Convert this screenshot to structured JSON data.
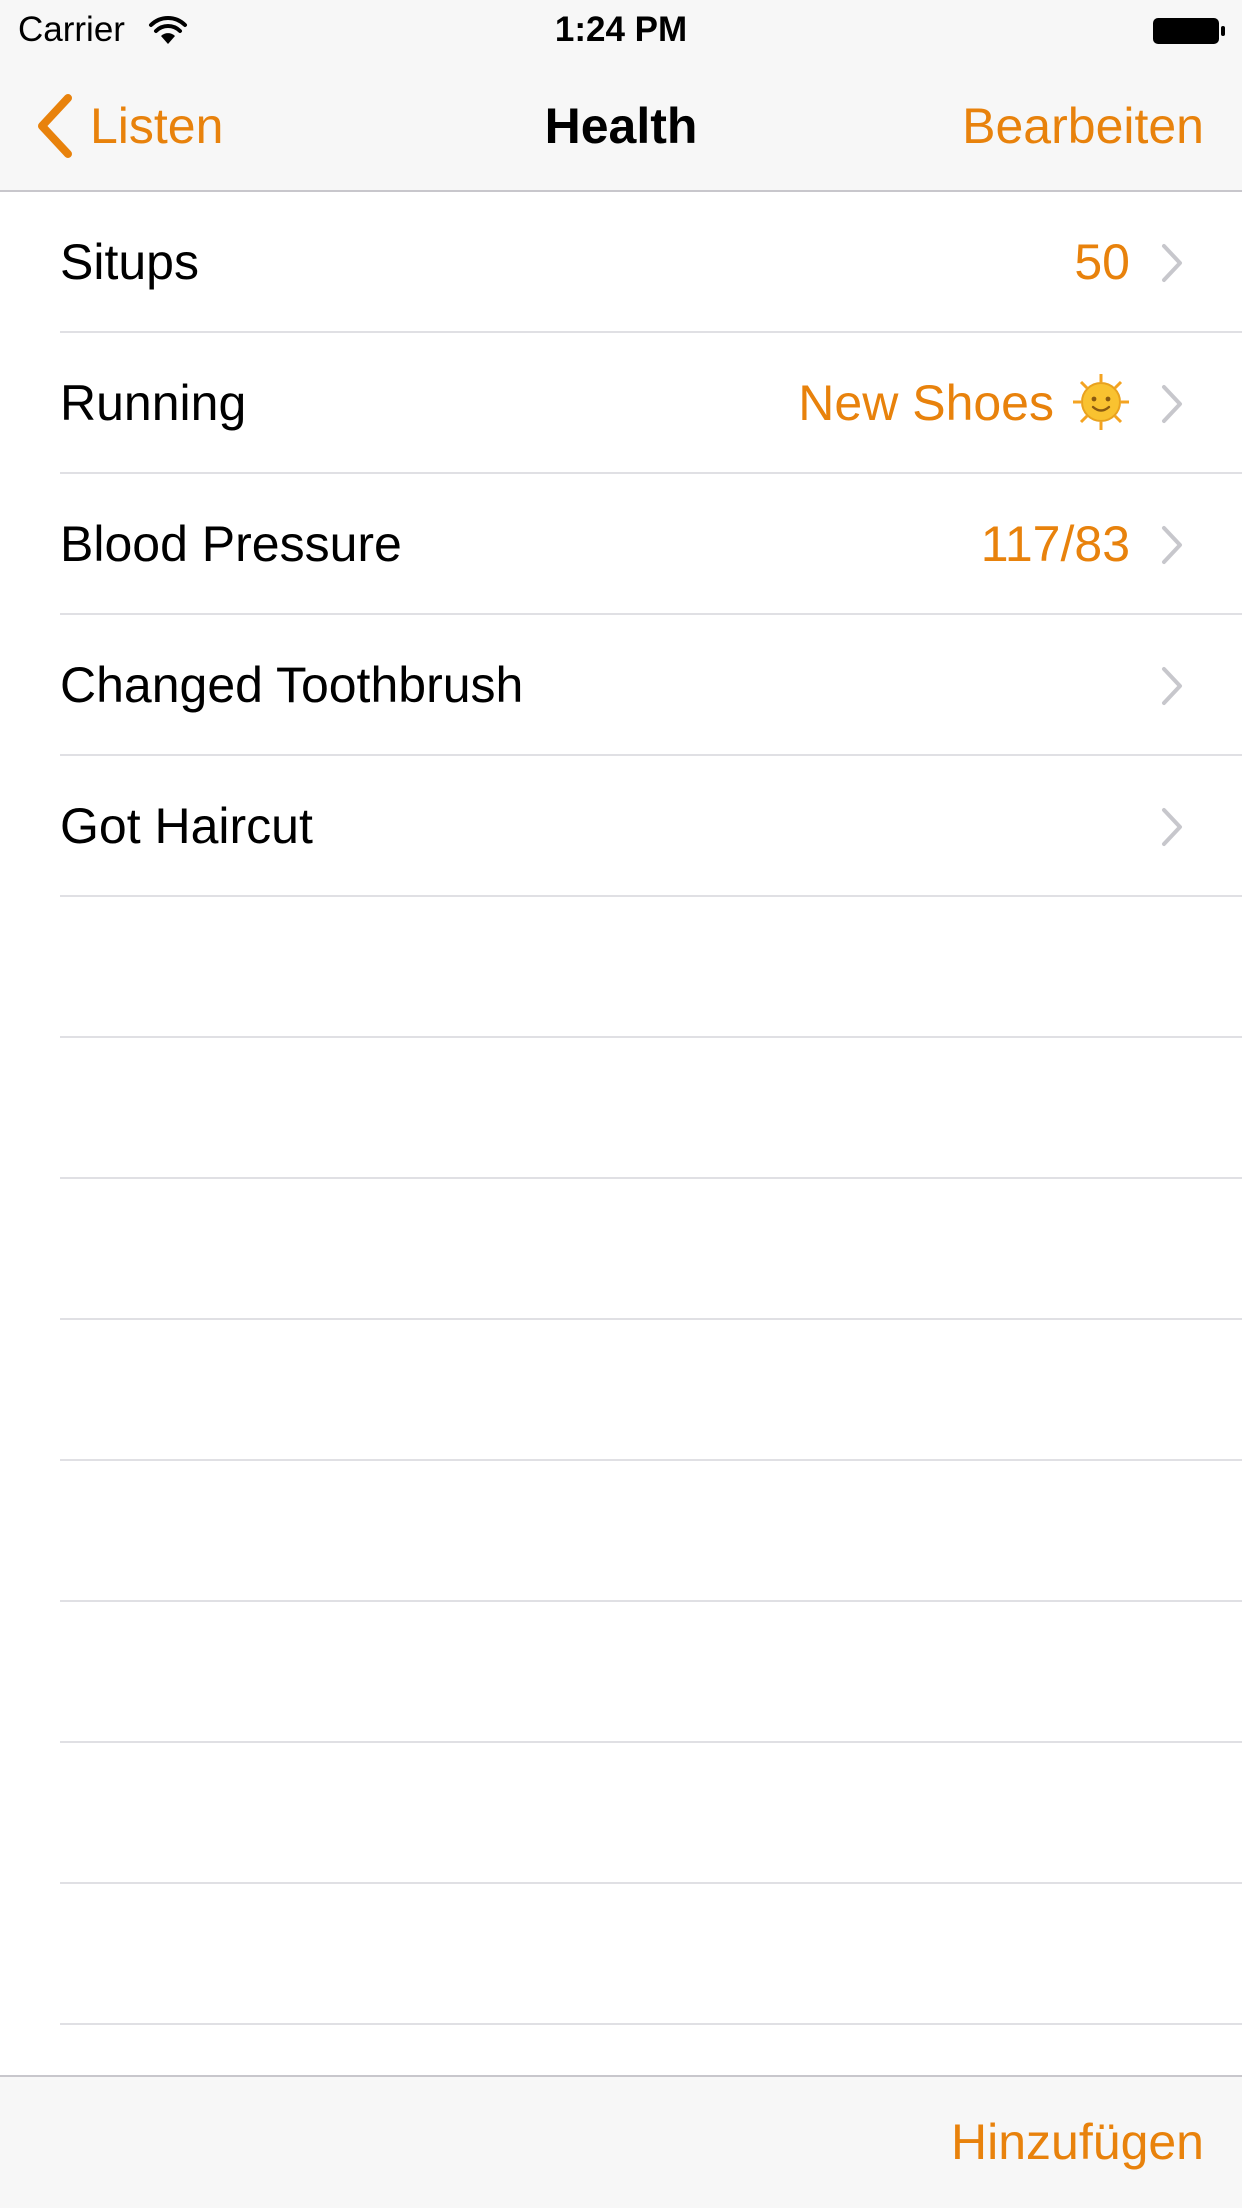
{
  "status_bar": {
    "carrier": "Carrier",
    "time": "1:24 PM",
    "wifi_icon": "wifi-icon",
    "battery_icon": "battery-full-icon"
  },
  "nav": {
    "back_label": "Listen",
    "title": "Health",
    "edit_label": "Bearbeiten"
  },
  "items": [
    {
      "title": "Situps",
      "detail": "50"
    },
    {
      "title": "Running",
      "detail": "New Shoes",
      "detail_icon": "sun-with-face-icon"
    },
    {
      "title": "Blood Pressure",
      "detail": "117/83"
    },
    {
      "title": "Changed Toothbrush",
      "detail": ""
    },
    {
      "title": "Got Haircut",
      "detail": ""
    }
  ],
  "empty_rows": 8,
  "toolbar": {
    "add_label": "Hinzufügen"
  },
  "colors": {
    "accent": "#e8820c",
    "bar_background": "#f7f7f7",
    "separator": "#e0e0e4",
    "chevron": "#c7c7cc"
  }
}
